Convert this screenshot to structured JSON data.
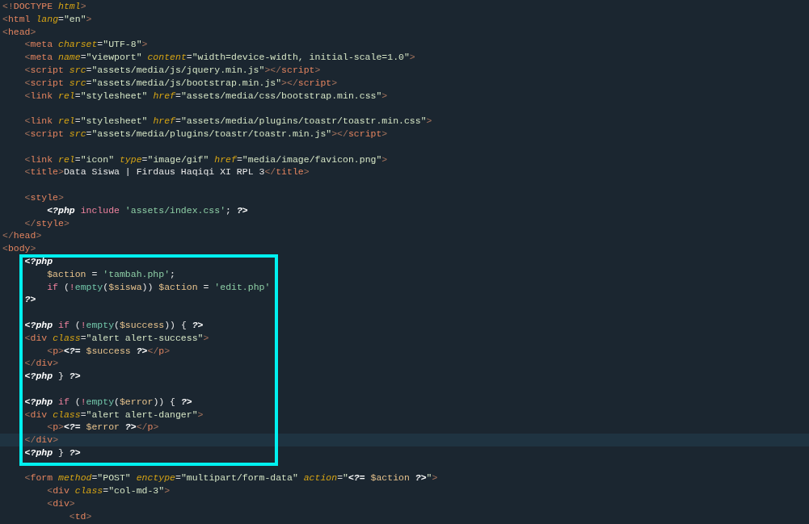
{
  "editor": {
    "lines": [
      {
        "boxed": false,
        "current": false,
        "tokens": [
          {
            "kind": "p",
            "text": "<!"
          },
          {
            "kind": "tag",
            "text": "DOCTYPE "
          },
          {
            "kind": "attr",
            "text": "html"
          },
          {
            "kind": "p",
            "text": ">"
          }
        ]
      },
      {
        "boxed": false,
        "current": false,
        "tokens": [
          {
            "kind": "p",
            "text": "<"
          },
          {
            "kind": "tag",
            "text": "html "
          },
          {
            "kind": "attr",
            "text": "lang"
          },
          {
            "kind": "eq",
            "text": "="
          },
          {
            "kind": "str",
            "text": "\"en\""
          },
          {
            "kind": "p",
            "text": ">"
          }
        ]
      },
      {
        "boxed": false,
        "current": false,
        "tokens": [
          {
            "kind": "p",
            "text": "<"
          },
          {
            "kind": "tag",
            "text": "head"
          },
          {
            "kind": "p",
            "text": ">"
          }
        ]
      },
      {
        "boxed": false,
        "current": false,
        "tokens": [
          {
            "kind": "p",
            "text": "    <"
          },
          {
            "kind": "tag",
            "text": "meta "
          },
          {
            "kind": "attr",
            "text": "charset"
          },
          {
            "kind": "eq",
            "text": "="
          },
          {
            "kind": "str",
            "text": "\"UTF-8\""
          },
          {
            "kind": "p",
            "text": ">"
          }
        ]
      },
      {
        "boxed": false,
        "current": false,
        "tokens": [
          {
            "kind": "p",
            "text": "    <"
          },
          {
            "kind": "tag",
            "text": "meta "
          },
          {
            "kind": "attr",
            "text": "name"
          },
          {
            "kind": "eq",
            "text": "="
          },
          {
            "kind": "str",
            "text": "\"viewport\" "
          },
          {
            "kind": "attr",
            "text": "content"
          },
          {
            "kind": "eq",
            "text": "="
          },
          {
            "kind": "str",
            "text": "\"width=device-width, initial-scale=1.0\""
          },
          {
            "kind": "p",
            "text": ">"
          }
        ]
      },
      {
        "boxed": false,
        "current": false,
        "tokens": [
          {
            "kind": "p",
            "text": "    <"
          },
          {
            "kind": "tag",
            "text": "script "
          },
          {
            "kind": "attr",
            "text": "src"
          },
          {
            "kind": "eq",
            "text": "="
          },
          {
            "kind": "str",
            "text": "\"assets/media/js/jquery.min.js\""
          },
          {
            "kind": "p",
            "text": "></"
          },
          {
            "kind": "tag",
            "text": "script"
          },
          {
            "kind": "p",
            "text": ">"
          }
        ]
      },
      {
        "boxed": false,
        "current": false,
        "tokens": [
          {
            "kind": "p",
            "text": "    <"
          },
          {
            "kind": "tag",
            "text": "script "
          },
          {
            "kind": "attr",
            "text": "src"
          },
          {
            "kind": "eq",
            "text": "="
          },
          {
            "kind": "str",
            "text": "\"assets/media/js/bootstrap.min.js\""
          },
          {
            "kind": "p",
            "text": "></"
          },
          {
            "kind": "tag",
            "text": "script"
          },
          {
            "kind": "p",
            "text": ">"
          }
        ]
      },
      {
        "boxed": false,
        "current": false,
        "tokens": [
          {
            "kind": "p",
            "text": "    <"
          },
          {
            "kind": "tag",
            "text": "link "
          },
          {
            "kind": "attr",
            "text": "rel"
          },
          {
            "kind": "eq",
            "text": "="
          },
          {
            "kind": "str",
            "text": "\"stylesheet\" "
          },
          {
            "kind": "attr",
            "text": "href"
          },
          {
            "kind": "eq",
            "text": "="
          },
          {
            "kind": "str",
            "text": "\"assets/media/css/bootstrap.min.css\""
          },
          {
            "kind": "p",
            "text": ">"
          }
        ]
      },
      {
        "boxed": false,
        "current": false
      },
      {
        "boxed": false,
        "current": false,
        "tokens": [
          {
            "kind": "p",
            "text": "    <"
          },
          {
            "kind": "tag",
            "text": "link "
          },
          {
            "kind": "attr",
            "text": "rel"
          },
          {
            "kind": "eq",
            "text": "="
          },
          {
            "kind": "str",
            "text": "\"stylesheet\" "
          },
          {
            "kind": "attr",
            "text": "href"
          },
          {
            "kind": "eq",
            "text": "="
          },
          {
            "kind": "str",
            "text": "\"assets/media/plugins/toastr/toastr.min.css\""
          },
          {
            "kind": "p",
            "text": ">"
          }
        ]
      },
      {
        "boxed": false,
        "current": false,
        "tokens": [
          {
            "kind": "p",
            "text": "    <"
          },
          {
            "kind": "tag",
            "text": "script "
          },
          {
            "kind": "attr",
            "text": "src"
          },
          {
            "kind": "eq",
            "text": "="
          },
          {
            "kind": "str",
            "text": "\"assets/media/plugins/toastr/toastr.min.js\""
          },
          {
            "kind": "p",
            "text": "></"
          },
          {
            "kind": "tag",
            "text": "script"
          },
          {
            "kind": "p",
            "text": ">"
          }
        ]
      },
      {
        "boxed": false,
        "current": false
      },
      {
        "boxed": false,
        "current": false,
        "tokens": [
          {
            "kind": "p",
            "text": "    <"
          },
          {
            "kind": "tag",
            "text": "link "
          },
          {
            "kind": "attr",
            "text": "rel"
          },
          {
            "kind": "eq",
            "text": "="
          },
          {
            "kind": "str",
            "text": "\"icon\" "
          },
          {
            "kind": "attr",
            "text": "type"
          },
          {
            "kind": "eq",
            "text": "="
          },
          {
            "kind": "str",
            "text": "\"image/gif\" "
          },
          {
            "kind": "attr",
            "text": "href"
          },
          {
            "kind": "eq",
            "text": "="
          },
          {
            "kind": "str",
            "text": "\"media/image/favicon.png\""
          },
          {
            "kind": "p",
            "text": ">"
          }
        ]
      },
      {
        "boxed": false,
        "current": false,
        "tokens": [
          {
            "kind": "p",
            "text": "    <"
          },
          {
            "kind": "tag",
            "text": "title"
          },
          {
            "kind": "p",
            "text": ">"
          },
          {
            "kind": "txt",
            "text": "Data Siswa | Firdaus Haqiqi XI RPL 3"
          },
          {
            "kind": "p",
            "text": "</"
          },
          {
            "kind": "tag",
            "text": "title"
          },
          {
            "kind": "p",
            "text": ">"
          }
        ]
      },
      {
        "boxed": false,
        "current": false
      },
      {
        "boxed": false,
        "current": false,
        "tokens": [
          {
            "kind": "p",
            "text": "    <"
          },
          {
            "kind": "tag",
            "text": "style"
          },
          {
            "kind": "p",
            "text": ">"
          }
        ]
      },
      {
        "boxed": false,
        "current": false,
        "tokens": [
          {
            "kind": "php",
            "text": "        <?php "
          },
          {
            "kind": "kw",
            "text": "include "
          },
          {
            "kind": "pstr",
            "text": "'assets/index.css'"
          },
          {
            "kind": "txt",
            "text": "; "
          },
          {
            "kind": "php",
            "text": "?>"
          }
        ]
      },
      {
        "boxed": false,
        "current": false,
        "tokens": [
          {
            "kind": "p",
            "text": "    </"
          },
          {
            "kind": "tag",
            "text": "style"
          },
          {
            "kind": "p",
            "text": ">"
          }
        ]
      },
      {
        "boxed": false,
        "current": false,
        "tokens": [
          {
            "kind": "p",
            "text": "</"
          },
          {
            "kind": "tag",
            "text": "head"
          },
          {
            "kind": "p",
            "text": ">"
          }
        ]
      },
      {
        "boxed": false,
        "current": false,
        "tokens": [
          {
            "kind": "p",
            "text": "<"
          },
          {
            "kind": "tag",
            "text": "body"
          },
          {
            "kind": "p",
            "text": ">"
          }
        ]
      },
      {
        "boxed": true,
        "current": false,
        "tokens": [
          {
            "kind": "php",
            "text": "    <?php"
          }
        ]
      },
      {
        "boxed": true,
        "current": false,
        "tokens": [
          {
            "kind": "var",
            "text": "        $action "
          },
          {
            "kind": "txt",
            "text": "= "
          },
          {
            "kind": "pstr",
            "text": "'tambah.php'"
          },
          {
            "kind": "txt",
            "text": ";"
          }
        ]
      },
      {
        "boxed": true,
        "current": false,
        "tokens": [
          {
            "kind": "kw",
            "text": "        if "
          },
          {
            "kind": "txt",
            "text": "("
          },
          {
            "kind": "kw",
            "text": "!"
          },
          {
            "kind": "fn",
            "text": "empty"
          },
          {
            "kind": "txt",
            "text": "("
          },
          {
            "kind": "var",
            "text": "$siswa"
          },
          {
            "kind": "txt",
            "text": ")) "
          },
          {
            "kind": "var",
            "text": "$action "
          },
          {
            "kind": "txt",
            "text": "= "
          },
          {
            "kind": "pstr",
            "text": "'edit.php'"
          }
        ]
      },
      {
        "boxed": true,
        "current": false,
        "tokens": [
          {
            "kind": "php",
            "text": "    ?>"
          }
        ]
      },
      {
        "boxed": true,
        "current": false
      },
      {
        "boxed": true,
        "current": false,
        "tokens": [
          {
            "kind": "php",
            "text": "    <?php "
          },
          {
            "kind": "kw",
            "text": "if "
          },
          {
            "kind": "txt",
            "text": "("
          },
          {
            "kind": "kw",
            "text": "!"
          },
          {
            "kind": "fn",
            "text": "empty"
          },
          {
            "kind": "txt",
            "text": "("
          },
          {
            "kind": "var",
            "text": "$success"
          },
          {
            "kind": "txt",
            "text": ")) { "
          },
          {
            "kind": "php",
            "text": "?>"
          }
        ]
      },
      {
        "boxed": true,
        "current": false,
        "tokens": [
          {
            "kind": "p",
            "text": "    <"
          },
          {
            "kind": "tag",
            "text": "div "
          },
          {
            "kind": "attr",
            "text": "class"
          },
          {
            "kind": "eq",
            "text": "="
          },
          {
            "kind": "str",
            "text": "\"alert alert-success\""
          },
          {
            "kind": "p",
            "text": ">"
          }
        ]
      },
      {
        "boxed": true,
        "current": false,
        "tokens": [
          {
            "kind": "p",
            "text": "        <"
          },
          {
            "kind": "tag",
            "text": "p"
          },
          {
            "kind": "p",
            "text": ">"
          },
          {
            "kind": "php",
            "text": "<?= "
          },
          {
            "kind": "var",
            "text": "$success "
          },
          {
            "kind": "php",
            "text": "?>"
          },
          {
            "kind": "p",
            "text": "</"
          },
          {
            "kind": "tag",
            "text": "p"
          },
          {
            "kind": "p",
            "text": ">"
          }
        ]
      },
      {
        "boxed": true,
        "current": false,
        "tokens": [
          {
            "kind": "p",
            "text": "    </"
          },
          {
            "kind": "tag",
            "text": "div"
          },
          {
            "kind": "p",
            "text": ">"
          }
        ]
      },
      {
        "boxed": true,
        "current": false,
        "tokens": [
          {
            "kind": "php",
            "text": "    <?php "
          },
          {
            "kind": "txt",
            "text": "} "
          },
          {
            "kind": "php",
            "text": "?>"
          }
        ]
      },
      {
        "boxed": true,
        "current": false
      },
      {
        "boxed": true,
        "current": false,
        "tokens": [
          {
            "kind": "php",
            "text": "    <?php "
          },
          {
            "kind": "kw",
            "text": "if "
          },
          {
            "kind": "txt",
            "text": "("
          },
          {
            "kind": "kw",
            "text": "!"
          },
          {
            "kind": "fn",
            "text": "empty"
          },
          {
            "kind": "txt",
            "text": "("
          },
          {
            "kind": "var",
            "text": "$error"
          },
          {
            "kind": "txt",
            "text": ")) { "
          },
          {
            "kind": "php",
            "text": "?>"
          }
        ]
      },
      {
        "boxed": true,
        "current": false,
        "tokens": [
          {
            "kind": "p",
            "text": "    <"
          },
          {
            "kind": "tag",
            "text": "div "
          },
          {
            "kind": "attr",
            "text": "class"
          },
          {
            "kind": "eq",
            "text": "="
          },
          {
            "kind": "str",
            "text": "\"alert alert-danger\""
          },
          {
            "kind": "p",
            "text": ">"
          }
        ]
      },
      {
        "boxed": true,
        "current": false,
        "tokens": [
          {
            "kind": "p",
            "text": "        <"
          },
          {
            "kind": "tag",
            "text": "p"
          },
          {
            "kind": "p",
            "text": ">"
          },
          {
            "kind": "php",
            "text": "<?= "
          },
          {
            "kind": "var",
            "text": "$error "
          },
          {
            "kind": "php",
            "text": "?>"
          },
          {
            "kind": "p",
            "text": "</"
          },
          {
            "kind": "tag",
            "text": "p"
          },
          {
            "kind": "p",
            "text": ">"
          }
        ]
      },
      {
        "boxed": true,
        "current": true,
        "tokens": [
          {
            "kind": "p",
            "text": "    </"
          },
          {
            "kind": "tag",
            "text": "div"
          },
          {
            "kind": "p",
            "text": ">"
          }
        ]
      },
      {
        "boxed": true,
        "current": false,
        "tokens": [
          {
            "kind": "php",
            "text": "    <?php "
          },
          {
            "kind": "txt",
            "text": "} "
          },
          {
            "kind": "php",
            "text": "?>"
          }
        ]
      },
      {
        "boxed": false,
        "current": false
      },
      {
        "boxed": false,
        "current": false,
        "tokens": [
          {
            "kind": "p",
            "text": "    <"
          },
          {
            "kind": "tag",
            "text": "form "
          },
          {
            "kind": "attr",
            "text": "method"
          },
          {
            "kind": "eq",
            "text": "="
          },
          {
            "kind": "str",
            "text": "\"POST\" "
          },
          {
            "kind": "attr",
            "text": "enctype"
          },
          {
            "kind": "eq",
            "text": "="
          },
          {
            "kind": "str",
            "text": "\"multipart/form-data\" "
          },
          {
            "kind": "attr",
            "text": "action"
          },
          {
            "kind": "eq",
            "text": "="
          },
          {
            "kind": "str",
            "text": "\""
          },
          {
            "kind": "php",
            "text": "<?= "
          },
          {
            "kind": "var",
            "text": "$action "
          },
          {
            "kind": "php",
            "text": "?>"
          },
          {
            "kind": "str",
            "text": "\""
          },
          {
            "kind": "p",
            "text": ">"
          }
        ]
      },
      {
        "boxed": false,
        "current": false,
        "tokens": [
          {
            "kind": "p",
            "text": "        <"
          },
          {
            "kind": "tag",
            "text": "div "
          },
          {
            "kind": "attr",
            "text": "class"
          },
          {
            "kind": "eq",
            "text": "="
          },
          {
            "kind": "str",
            "text": "\"col-md-3\""
          },
          {
            "kind": "p",
            "text": ">"
          }
        ]
      },
      {
        "boxed": false,
        "current": false,
        "tokens": [
          {
            "kind": "p",
            "text": "        <"
          },
          {
            "kind": "tag",
            "text": "div"
          },
          {
            "kind": "p",
            "text": ">"
          }
        ]
      },
      {
        "boxed": false,
        "current": false,
        "tokens": [
          {
            "kind": "p",
            "text": "            <"
          },
          {
            "kind": "tag",
            "text": "td"
          },
          {
            "kind": "p",
            "text": ">"
          }
        ]
      }
    ]
  }
}
